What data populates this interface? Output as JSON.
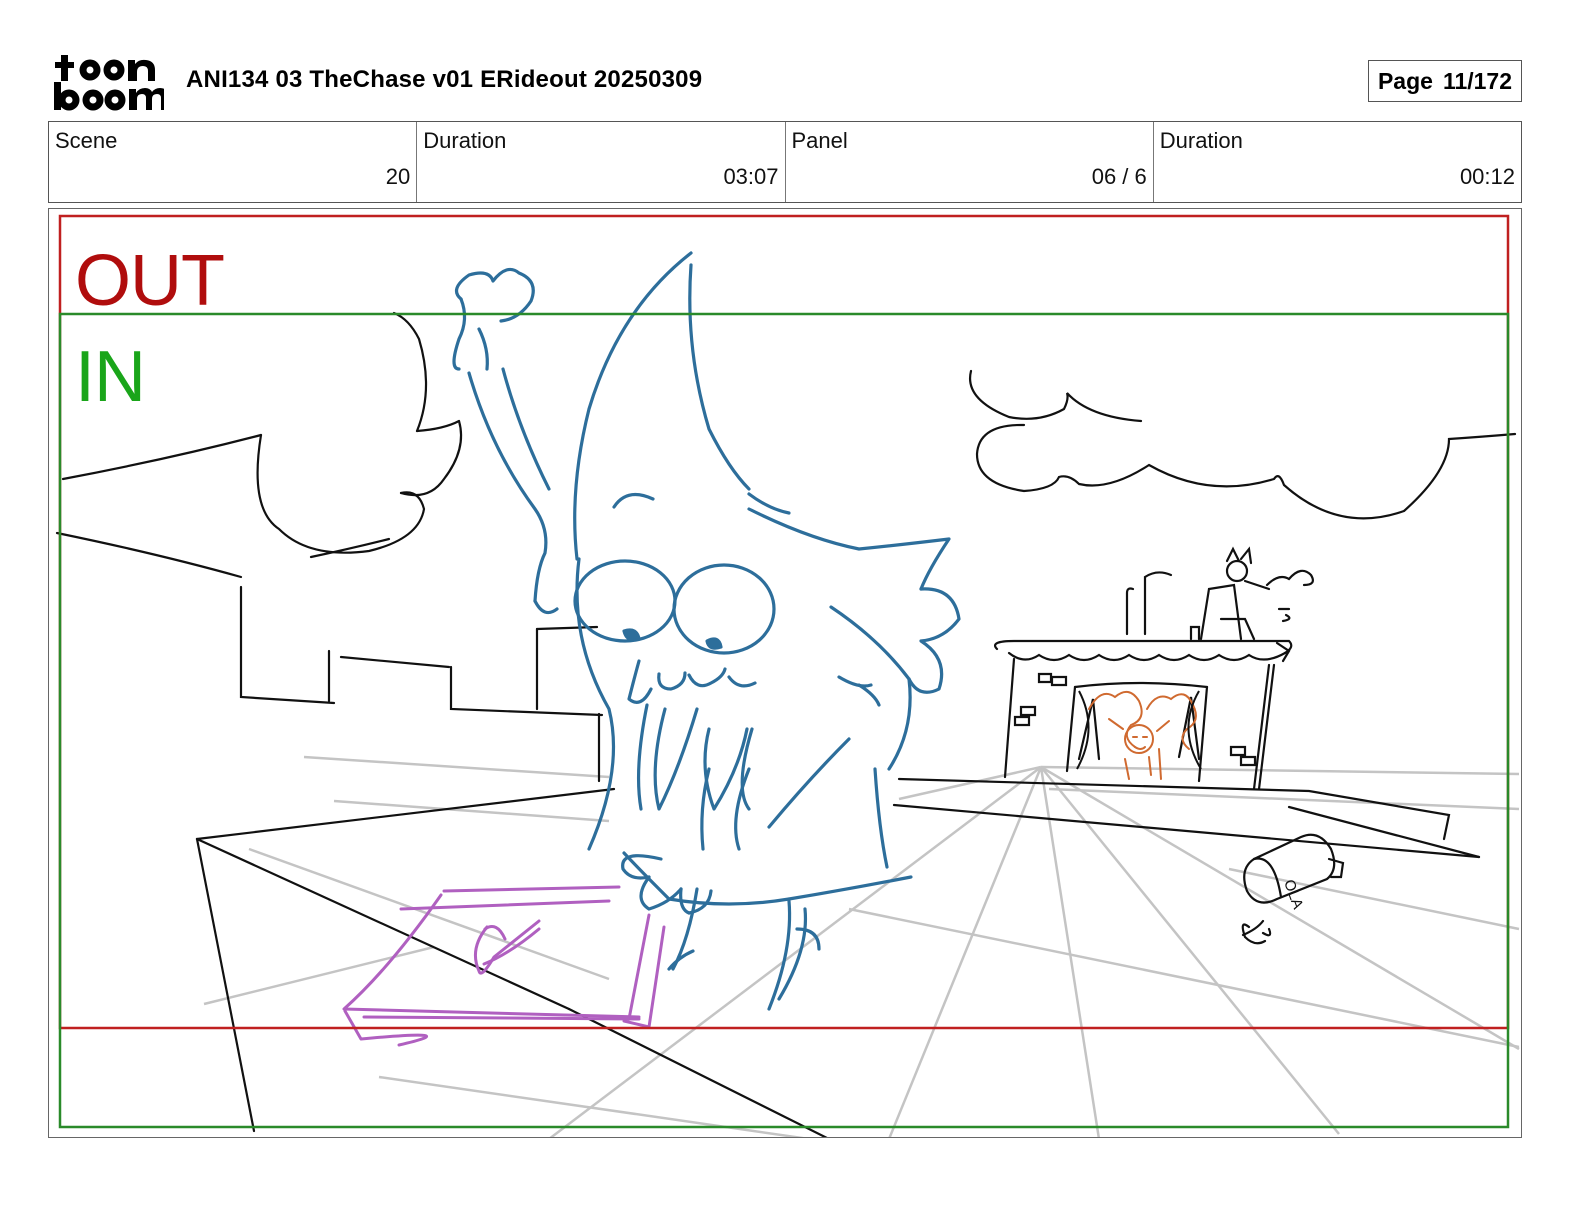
{
  "header": {
    "logo_text": "toon boom",
    "title": "ANI134 03 TheChase v01 ERideout 20250309",
    "page_label": "Page",
    "page_value": "11/172"
  },
  "info": [
    {
      "label": "Scene",
      "value": "20"
    },
    {
      "label": "Duration",
      "value": "03:07"
    },
    {
      "label": "Panel",
      "value": "06 / 6"
    },
    {
      "label": "Duration",
      "value": "00:12"
    }
  ],
  "panel": {
    "out_label": "OUT",
    "in_label": "IN",
    "can_text": "OLA"
  },
  "colors": {
    "out_frame": "#c02020",
    "in_frame": "#2a8a2a",
    "character": "#2d6e9b",
    "box": "#b060c0",
    "figure": "#d06a30",
    "perspective": "#c4c4c4"
  }
}
